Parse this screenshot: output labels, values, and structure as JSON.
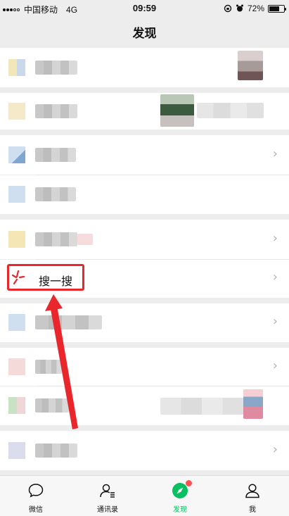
{
  "status_bar": {
    "carrier": "中国移动",
    "network": "4G",
    "time": "09:59",
    "battery": "72%",
    "battery_level": 0.72
  },
  "nav": {
    "title": "发现"
  },
  "search_item": {
    "label": "搜一搜"
  },
  "tabs": [
    {
      "label": "微信",
      "icon": "chat-bubble-icon"
    },
    {
      "label": "通讯录",
      "icon": "contacts-icon"
    },
    {
      "label": "发现",
      "icon": "compass-icon"
    },
    {
      "label": "我",
      "icon": "person-icon"
    }
  ],
  "colors": {
    "accent": "#07c160",
    "highlight": "#e8262b",
    "badge": "#fa5151",
    "background": "#ededed"
  }
}
